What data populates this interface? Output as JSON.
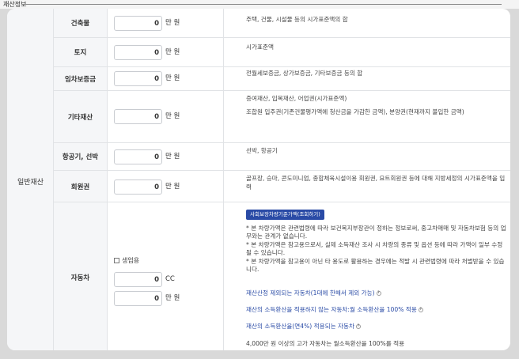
{
  "section_title": "재산정보",
  "category": "일반재산",
  "rows": [
    {
      "label": "건축물",
      "value": "0",
      "unit": "만 원",
      "desc": [
        "주택, 건물, 시설물 등의 시가표준액의 합"
      ]
    },
    {
      "label": "토지",
      "value": "0",
      "unit": "만 원",
      "desc": [
        "시가표준액"
      ]
    },
    {
      "label": "임차보증금",
      "value": "0",
      "unit": "만 원",
      "desc": [
        "전월세보증금, 상가보증금, 기타보증금 등의 합"
      ]
    },
    {
      "label": "기타재산",
      "value": "0",
      "unit": "만 원",
      "desc": [
        "증여재산, 입목재산, 어업권(시가표준액)",
        "조합원 입주권(기존건물평가액에 청산금을 가감한 금액), 분양권(현재까지 불입한 금액)"
      ]
    },
    {
      "label": "항공기, 선박",
      "value": "0",
      "unit": "만 원",
      "desc": [
        "선박, 항공기"
      ]
    },
    {
      "label": "회원권",
      "value": "0",
      "unit": "만 원",
      "desc": [
        "골프장, 승마, 콘도미니엄, 종합체육시설이용 회원권, 요트회원권 등에 대해 지방세정의 시가표준액을 입력"
      ]
    }
  ],
  "car": {
    "label": "자동차",
    "checkbox_label": "생업용",
    "cc_value": "0",
    "cc_unit": "CC",
    "price_value": "0",
    "price_unit": "만 원",
    "lookup_button": "사회보장차량기준가액(조회하기)",
    "notes": [
      "* 본 차량가액은 관련법령에 따라 보건복지부장관이 정하는 정보로써, 중고차매매 및 자동차보험 등의 업무와는 관계가 없습니다.",
      "* 본 차량가액은 참고용으로서, 실제 소득재산 조사 시 차량의 종류 및 옵션 등에 따라 가액이 일부 수정될 수 있습니다.",
      "* 본 차량가액을 참고용이 아닌 타 용도로 활용하는 경우에는 적발 시 관련법령에 따라 처벌받을 수 있습니다."
    ],
    "link1": "재산산정 제외되는 자동차(1대에 한해서 제외 가능)",
    "link2": "재산의 소득환산을 적용하지 않는 자동차:월 소득환산율 100% 적용",
    "link3": "재산의 소득환산율(연4%) 적용되는 자동차",
    "footer": "4,000만 원 이상의 고가 자동차는 월소득환산율 100%를 적용",
    "help_glyph": "?"
  }
}
